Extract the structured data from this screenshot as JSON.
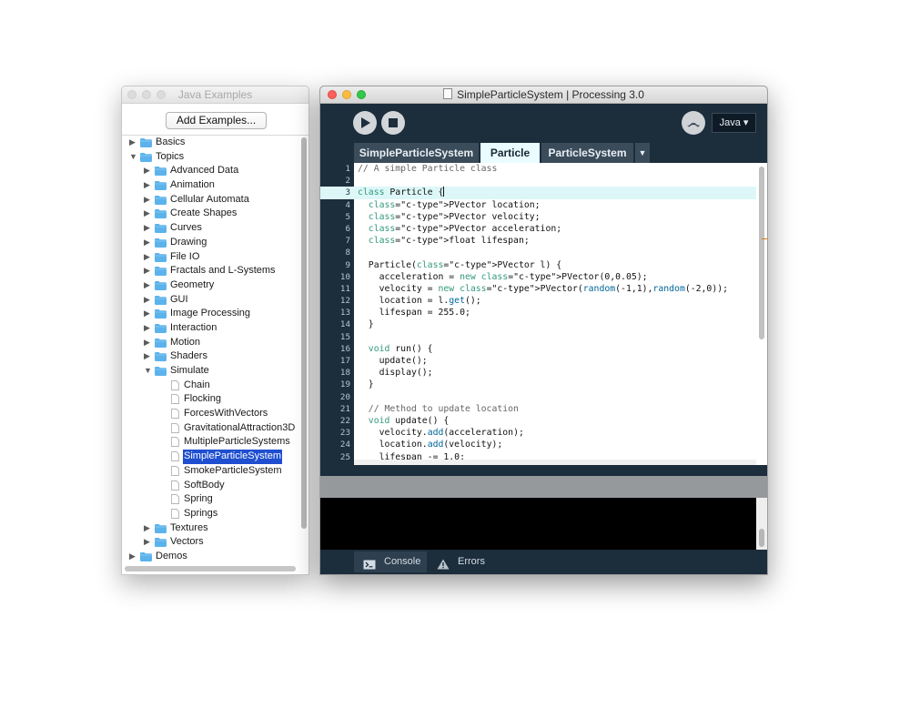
{
  "examples_window": {
    "title": "Java Examples",
    "add_button": "Add Examples...",
    "tree": [
      {
        "label": "Basics",
        "depth": 0,
        "kind": "folder",
        "expanded": false
      },
      {
        "label": "Topics",
        "depth": 0,
        "kind": "folder",
        "expanded": true
      },
      {
        "label": "Advanced Data",
        "depth": 1,
        "kind": "folder",
        "expanded": false
      },
      {
        "label": "Animation",
        "depth": 1,
        "kind": "folder",
        "expanded": false
      },
      {
        "label": "Cellular Automata",
        "depth": 1,
        "kind": "folder",
        "expanded": false
      },
      {
        "label": "Create Shapes",
        "depth": 1,
        "kind": "folder",
        "expanded": false
      },
      {
        "label": "Curves",
        "depth": 1,
        "kind": "folder",
        "expanded": false
      },
      {
        "label": "Drawing",
        "depth": 1,
        "kind": "folder",
        "expanded": false
      },
      {
        "label": "File IO",
        "depth": 1,
        "kind": "folder",
        "expanded": false
      },
      {
        "label": "Fractals and L-Systems",
        "depth": 1,
        "kind": "folder",
        "expanded": false
      },
      {
        "label": "Geometry",
        "depth": 1,
        "kind": "folder",
        "expanded": false
      },
      {
        "label": "GUI",
        "depth": 1,
        "kind": "folder",
        "expanded": false
      },
      {
        "label": "Image Processing",
        "depth": 1,
        "kind": "folder",
        "expanded": false
      },
      {
        "label": "Interaction",
        "depth": 1,
        "kind": "folder",
        "expanded": false
      },
      {
        "label": "Motion",
        "depth": 1,
        "kind": "folder",
        "expanded": false
      },
      {
        "label": "Shaders",
        "depth": 1,
        "kind": "folder",
        "expanded": false
      },
      {
        "label": "Simulate",
        "depth": 1,
        "kind": "folder",
        "expanded": true
      },
      {
        "label": "Chain",
        "depth": 2,
        "kind": "file"
      },
      {
        "label": "Flocking",
        "depth": 2,
        "kind": "file"
      },
      {
        "label": "ForcesWithVectors",
        "depth": 2,
        "kind": "file"
      },
      {
        "label": "GravitationalAttraction3D",
        "depth": 2,
        "kind": "file"
      },
      {
        "label": "MultipleParticleSystems",
        "depth": 2,
        "kind": "file"
      },
      {
        "label": "SimpleParticleSystem",
        "depth": 2,
        "kind": "file",
        "selected": true
      },
      {
        "label": "SmokeParticleSystem",
        "depth": 2,
        "kind": "file"
      },
      {
        "label": "SoftBody",
        "depth": 2,
        "kind": "file"
      },
      {
        "label": "Spring",
        "depth": 2,
        "kind": "file"
      },
      {
        "label": "Springs",
        "depth": 2,
        "kind": "file"
      },
      {
        "label": "Textures",
        "depth": 1,
        "kind": "folder",
        "expanded": false
      },
      {
        "label": "Vectors",
        "depth": 1,
        "kind": "folder",
        "expanded": false
      },
      {
        "label": "Demos",
        "depth": 0,
        "kind": "folder",
        "expanded": false
      }
    ]
  },
  "processing_window": {
    "title": "SimpleParticleSystem | Processing 3.0",
    "toolbar": {
      "run_icon": "play-icon",
      "stop_icon": "stop-icon",
      "debug_icon": "debugger-icon",
      "debug_glyph": "෴",
      "mode_label": "Java ▾"
    },
    "tabs": [
      {
        "label": "SimpleParticleSystem",
        "active": false
      },
      {
        "label": "Particle",
        "active": true
      },
      {
        "label": "ParticleSystem",
        "active": false
      }
    ],
    "tab_menu_glyph": "▼",
    "current_line": 3,
    "code_lines": [
      "// A simple Particle class",
      "",
      "class Particle {",
      "  PVector location;",
      "  PVector velocity;",
      "  PVector acceleration;",
      "  float lifespan;",
      "",
      "  Particle(PVector l) {",
      "    acceleration = new PVector(0,0.05);",
      "    velocity = new PVector(random(-1,1),random(-2,0));",
      "    location = l.get();",
      "    lifespan = 255.0;",
      "  }",
      "",
      "  void run() {",
      "    update();",
      "    display();",
      "  }",
      "",
      "  // Method to update location",
      "  void update() {",
      "    velocity.add(acceleration);",
      "    location.add(velocity);",
      "    lifespan -= 1.0;"
    ],
    "footer_tabs": [
      {
        "label": "Console",
        "icon": "console-icon",
        "active": true
      },
      {
        "label": "Errors",
        "icon": "warning-icon",
        "active": false
      }
    ]
  },
  "colors": {
    "pde_background": "#1c2d3c",
    "active_tab": "#eafcff",
    "inactive_tab": "#3a4b5a",
    "selection": "#1f4fd0",
    "folder": "#5cb3ec",
    "keyword": "#33997e",
    "type": "#e2661a",
    "function": "#006699",
    "comment": "#666666",
    "traffic_close": "#fc605c",
    "traffic_min": "#fdbc40",
    "traffic_max": "#34c84a"
  }
}
